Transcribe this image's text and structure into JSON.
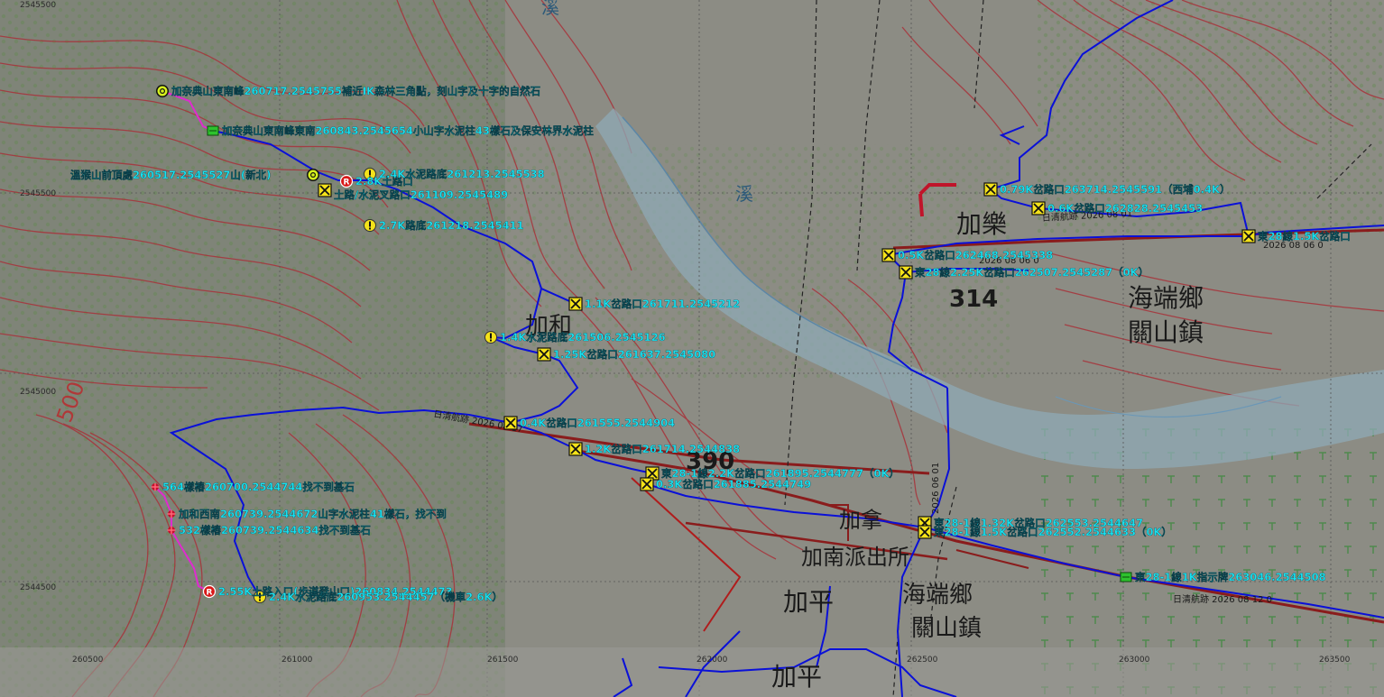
{
  "colors": {
    "label": "#19e3f2",
    "track": "#0a10d8",
    "pink_track": "#e02ad0",
    "contour": "#a8323a",
    "road": "#8a1c1c",
    "river": "#7fa6b8",
    "background": "#8c8c84"
  },
  "place_names": {
    "jiahe": "加和",
    "jiale": "加樂",
    "h314": "314",
    "h390": "390",
    "haiduan_1": "海端鄉",
    "guanshan_1": "關山鎮",
    "jiana": "加拿",
    "jianan_police": "加南派出所",
    "jiaping_1": "加平",
    "haiduan_2": "海端鄉",
    "guanshan_2": "關山鎮",
    "jiaping_2": "加平",
    "stream_1": "溪",
    "stream_2": "溪",
    "contour_500": "500"
  },
  "grid": {
    "top_left": "2545500",
    "y1": "2545500",
    "y2": "2545000",
    "y3": "2544500",
    "x1": "260500",
    "x2": "261000",
    "x3": "261500",
    "x4": "262000",
    "x5": "262500",
    "x6": "263000",
    "x7": "263500"
  },
  "road_notes": {
    "n1": "日清航跡 2026 08 01",
    "n2": "日清航跡 2026 08 17",
    "n3": "2026 08 06 0",
    "n4": "2026 06 01",
    "n5": "日清航跡 2026 08 12 0",
    "n6": "2026 08 06 0"
  },
  "waypoints": [
    {
      "icon": "summit-icon",
      "label": "加奈典山東南峰260717.2545755補近IK森林三角點，刻山字及十字的自然石"
    },
    {
      "icon": "flag-icon",
      "label": "加奈典山東南峰東南260843.2545654小山字水泥柱43樣石及保安林界水泥柱"
    },
    {
      "icon": "summit-icon",
      "label": "溫猴山前頂處260517.2545527山(新北)"
    },
    {
      "icon": "restaurant-icon",
      "label": "2.8K土路口"
    },
    {
      "icon": "warning-icon",
      "label": "2.4K水泥路底261213.2545538"
    },
    {
      "icon": "junction-icon",
      "label": "土路/水泥叉路口261109.2545489"
    },
    {
      "icon": "warning-icon",
      "label": "2.7K路底261218.2545411"
    },
    {
      "icon": "junction-icon",
      "label": "1.1K岔路口261711.2545212"
    },
    {
      "icon": "warning-icon",
      "label": "1.4K水泥路底261506.2545126"
    },
    {
      "icon": "junction-icon",
      "label": "1.25K岔路口261637.2545080"
    },
    {
      "icon": "junction-icon",
      "label": "0.4K岔路口261555.2544904"
    },
    {
      "icon": "junction-icon",
      "label": "1.2K岔路口261714.2544838"
    },
    {
      "icon": "junction-icon",
      "label": "東28-1線2.2K岔路口261895.2544777（0K）"
    },
    {
      "icon": "junction-icon",
      "label": "0.3K岔路口261885.2544749"
    },
    {
      "icon": "junction-icon",
      "label": "0.79K岔路口263714.2545591（西埔0.4K）"
    },
    {
      "icon": "junction-icon",
      "label": "0.6K岔路口262828.2545453"
    },
    {
      "icon": "junction-icon",
      "label": "東28線1.5K岔路口"
    },
    {
      "icon": "junction-icon",
      "label": "0.5K岔路口262468.2545338"
    },
    {
      "icon": "junction-icon",
      "label": "東28線2.25K岔路口262507.2545287（0K）"
    },
    {
      "icon": "junction-icon",
      "label": "東28-1線1.32K岔路口262553.2544647"
    },
    {
      "icon": "junction-icon",
      "label": "東28-1線1.5K岔路口262552.2544633（0K）"
    },
    {
      "icon": "flag-icon",
      "label": "東28-1線1K指示牌263046.2544508"
    },
    {
      "icon": "cross-icon",
      "label": "564樣樁260700.2544744找不到基石"
    },
    {
      "icon": "cross-icon",
      "label": "加和西南260739.2544672山字水泥柱41樣石，找不到"
    },
    {
      "icon": "cross-icon",
      "label": "532樣樁260739.2544634找不到基石"
    },
    {
      "icon": "restaurant-icon",
      "label": "2.55K土路入口(步道登山口)260834.2544473"
    },
    {
      "icon": "warning-icon",
      "label": "2.4K水泥路底260953.2544457（機車2.6K）"
    }
  ]
}
